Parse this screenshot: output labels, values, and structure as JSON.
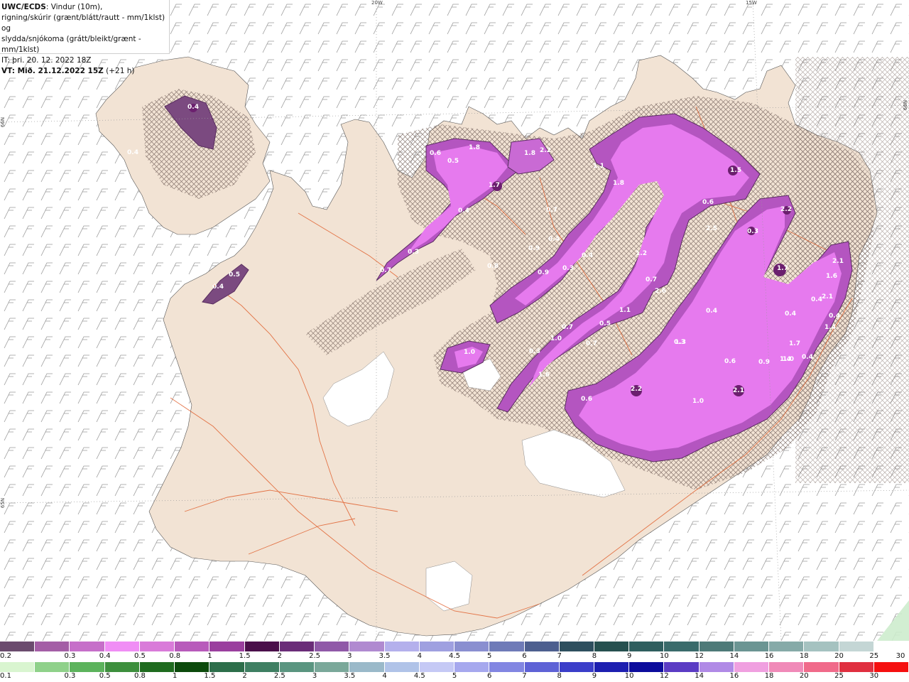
{
  "header": {
    "line1_bold": "UWC/ECDS",
    "line1_rest": ": Vindur (10m),",
    "line2": "rigning/skúrir (grænt/blátt/rautt - mm/1klst) og",
    "line3": "slydda/snjókoma (grátt/bleikt/grænt - mm/1klst)",
    "line4": "IT: þri. 20. 12. 2022 18Z",
    "line5_bold": "VT: Mið. 21.12.2022 15Z",
    "line5_rest": " (+21 h)"
  },
  "coords": {
    "lon_20w": "20W",
    "lon_15w": "15W",
    "lat_66n_left": "66N",
    "lat_65n_left": "65N",
    "lat_66n_right": "66N"
  },
  "colors": {
    "land": "#f2e3d4",
    "sea": "#ffffff",
    "roads": "#e0602e",
    "glacier": "#ffffff",
    "snow_light": "#f5a3f5",
    "snow_mid": "#e070e8",
    "snow_strong": "#b84fc4",
    "snow_peak": "#6b1f6e",
    "snow_edge": "#7b4a80"
  },
  "map_values": [
    {
      "label": "0.4"
    },
    {
      "label": "0.4"
    },
    {
      "label": "0.4"
    },
    {
      "label": "0.5"
    },
    {
      "label": "0.6"
    },
    {
      "label": "0.5"
    },
    {
      "label": "1.8"
    },
    {
      "label": "1.8"
    },
    {
      "label": "2.2"
    },
    {
      "label": "1.7"
    },
    {
      "label": "0.4"
    },
    {
      "label": "0.3"
    },
    {
      "label": "0.7"
    },
    {
      "label": "0.9"
    },
    {
      "label": "0.4"
    },
    {
      "label": "1.1"
    },
    {
      "label": "1.8"
    },
    {
      "label": "1.5"
    },
    {
      "label": "0.6"
    },
    {
      "label": "2.5"
    },
    {
      "label": "2.2"
    },
    {
      "label": "0.3"
    },
    {
      "label": "0.7"
    },
    {
      "label": "1.2"
    },
    {
      "label": "0.9"
    },
    {
      "label": "0.3"
    },
    {
      "label": "0.4"
    },
    {
      "label": "0.8"
    },
    {
      "label": "0.7"
    },
    {
      "label": "2.6"
    },
    {
      "label": "1.7"
    },
    {
      "label": "2.1"
    },
    {
      "label": "1.6"
    },
    {
      "label": "0.4"
    },
    {
      "label": "0.4"
    },
    {
      "label": "1.4"
    },
    {
      "label": "1.1"
    },
    {
      "label": "2.1"
    },
    {
      "label": "0.4"
    },
    {
      "label": "0.7"
    },
    {
      "label": "0.5"
    },
    {
      "label": "1.0"
    },
    {
      "label": "0.7"
    },
    {
      "label": "1.7"
    },
    {
      "label": "1.0"
    },
    {
      "label": "0.3"
    },
    {
      "label": "0.6"
    },
    {
      "label": "0.9"
    },
    {
      "label": "1.4"
    },
    {
      "label": "1.6"
    },
    {
      "label": "1.0"
    },
    {
      "label": "2.2"
    },
    {
      "label": "1.0"
    },
    {
      "label": "2.1"
    },
    {
      "label": "0.6"
    },
    {
      "label": "0.3"
    },
    {
      "label": "0.4"
    },
    {
      "label": "1.3"
    },
    {
      "label": "0.4"
    }
  ],
  "legend_snow": {
    "labels": [
      "0.2",
      "0.3",
      "0.4",
      "0.5",
      "0.8",
      "1",
      "1.5",
      "2",
      "2.5",
      "3",
      "3.5",
      "4",
      "4.5",
      "5",
      "6",
      "7",
      "8",
      "9",
      "10",
      "12",
      "14",
      "16",
      "18",
      "20",
      "25",
      "30"
    ],
    "colors": [
      "#6b4b6e",
      "#a45ea6",
      "#c66fc9",
      "#f08ef5",
      "#d97bd9",
      "#b85bbb",
      "#9a3f9e",
      "#4a0f4a",
      "#6a2c78",
      "#9059a8",
      "#b08ad0",
      "#b4b0ec",
      "#9fa0e0",
      "#8a8fd0",
      "#6f7bb8",
      "#4d5f8f",
      "#2e4f5e",
      "#26504f",
      "#2f5e5e",
      "#3a6b6b",
      "#4e7a78",
      "#6b9593",
      "#86aaa8",
      "#a5c2c0",
      "#c4d6d5",
      "#ffffff"
    ]
  },
  "legend_rain": {
    "labels": [
      "0.1",
      "0.3",
      "0.5",
      "0.8",
      "1",
      "1.5",
      "2",
      "2.5",
      "3",
      "3.5",
      "4",
      "4.5",
      "5",
      "6",
      "7",
      "8",
      "9",
      "10",
      "12",
      "14",
      "16",
      "18",
      "20",
      "25",
      "30"
    ],
    "colors": [
      "#d9f5d0",
      "#8fd18a",
      "#5cb35c",
      "#3d8f3d",
      "#1f6b1f",
      "#0c4a0c",
      "#2d6e4a",
      "#3f7f62",
      "#5a9580",
      "#7aa89a",
      "#9ab9c9",
      "#b0c3e8",
      "#c5c9f5",
      "#a6a8ee",
      "#8286e2",
      "#5e62d6",
      "#3b3ec9",
      "#1d1fb0",
      "#0c0c9c",
      "#5b3cc4",
      "#b08ae6",
      "#f0a0e0",
      "#f08ab8",
      "#f06a8a",
      "#e03040",
      "#f51010"
    ]
  }
}
